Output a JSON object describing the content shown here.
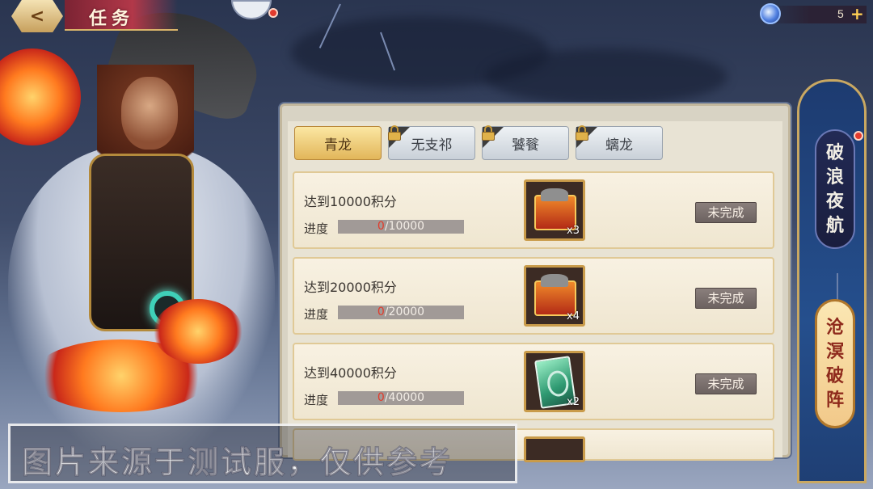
{
  "header": {
    "back_label": "<",
    "title": "任务"
  },
  "currency": {
    "value": "5",
    "plus_label": "+",
    "icon": "gem-icon"
  },
  "tabs": [
    {
      "label": "青龙",
      "active": true,
      "locked": false
    },
    {
      "label": "无支祁",
      "active": false,
      "locked": true
    },
    {
      "label": "饕餮",
      "active": false,
      "locked": true
    },
    {
      "label": "螭龙",
      "active": false,
      "locked": true
    }
  ],
  "tasks": [
    {
      "name": "达到10000积分",
      "progress_label": "进度",
      "current": "0",
      "total": "/10000",
      "progress": 0,
      "reward_icon": "chest-icon",
      "reward_qty": "x3",
      "status": "未完成"
    },
    {
      "name": "达到20000积分",
      "progress_label": "进度",
      "current": "0",
      "total": "/20000",
      "progress": 0,
      "reward_icon": "chest-icon",
      "reward_qty": "x4",
      "status": "未完成"
    },
    {
      "name": "达到40000积分",
      "progress_label": "进度",
      "current": "0",
      "total": "/40000",
      "progress": 0,
      "reward_icon": "dragon-card-icon",
      "reward_qty": "x2",
      "status": "未完成"
    }
  ],
  "side_tabs": [
    {
      "label": "破浪夜航",
      "chars": [
        "破",
        "浪",
        "夜",
        "航"
      ],
      "active": false
    },
    {
      "label": "沧溟破阵",
      "chars": [
        "沧",
        "溟",
        "破",
        "阵"
      ],
      "active": true
    }
  ],
  "watermark": "图片来源于测试服，仅供参考",
  "colors": {
    "accent_gold": "#e2b65a",
    "status_gray": "#6c6260",
    "progress_red": "#e23a2a"
  }
}
